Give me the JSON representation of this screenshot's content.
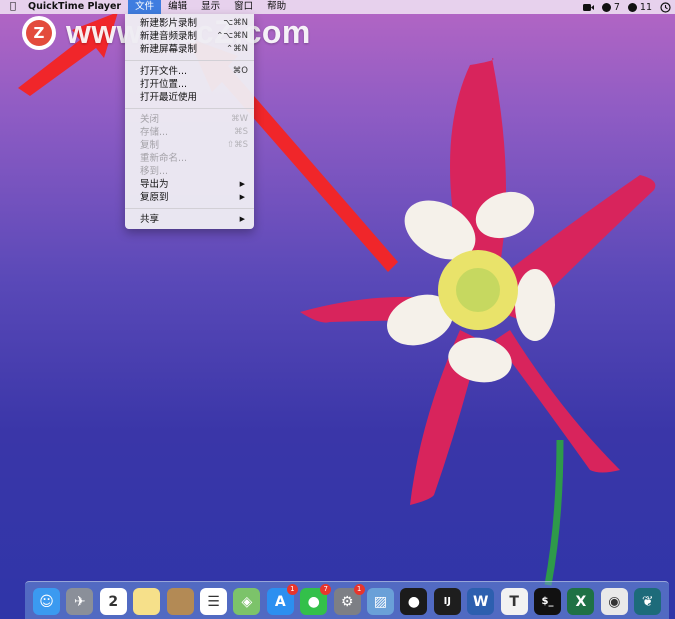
{
  "menubar": {
    "apple_icon": "",
    "app_name": "QuickTime Player",
    "menus": [
      "文件",
      "编辑",
      "显示",
      "窗口",
      "帮助"
    ],
    "active_menu_index": 0,
    "status": {
      "notification_count": "7",
      "account_count": "11"
    }
  },
  "watermark": {
    "logo_letter": "Z",
    "text": "www.MacZ.com"
  },
  "file_menu": {
    "items": [
      {
        "label": "新建影片录制",
        "shortcut": "⌥⌘N",
        "enabled": true
      },
      {
        "label": "新建音频录制",
        "shortcut": "⌃⌥⌘N",
        "enabled": true
      },
      {
        "label": "新建屏幕录制",
        "shortcut": "⌃⌘N",
        "enabled": true
      },
      {
        "label": "打开文件...",
        "shortcut": "⌘O",
        "enabled": true
      },
      {
        "label": "打开位置...",
        "shortcut": "",
        "enabled": true
      },
      {
        "label": "打开最近使用",
        "shortcut": "",
        "enabled": true,
        "submenu": true
      },
      {
        "label": "关闭",
        "shortcut": "⌘W",
        "enabled": false
      },
      {
        "label": "存储...",
        "shortcut": "⌘S",
        "enabled": false
      },
      {
        "label": "复制",
        "shortcut": "⇧⌘S",
        "enabled": false
      },
      {
        "label": "重新命名...",
        "shortcut": "",
        "enabled": false
      },
      {
        "label": "移到...",
        "shortcut": "",
        "enabled": false
      },
      {
        "label": "导出为",
        "shortcut": "",
        "enabled": true,
        "submenu": true
      },
      {
        "label": "复原到",
        "shortcut": "",
        "enabled": true,
        "submenu": true
      },
      {
        "label": "共享",
        "shortcut": "",
        "enabled": true,
        "submenu": true
      }
    ]
  },
  "dock": {
    "apps": [
      {
        "name": "finder-icon",
        "glyph": "☺",
        "color": "#3b9af0"
      },
      {
        "name": "launchpad-icon",
        "glyph": "✈",
        "color": "#8a8f99"
      },
      {
        "name": "calendar-icon",
        "glyph": "2",
        "color": "#ffffff"
      },
      {
        "name": "notes-icon",
        "glyph": "",
        "color": "#f6e08a"
      },
      {
        "name": "contacts-icon",
        "glyph": "",
        "color": "#b38a55"
      },
      {
        "name": "reminders-icon",
        "glyph": "☰",
        "color": "#ffffff"
      },
      {
        "name": "maps-icon",
        "glyph": "◈",
        "color": "#7cc36a"
      },
      {
        "name": "app-store-icon",
        "glyph": "A",
        "color": "#2c8ff0",
        "badge": "1"
      },
      {
        "name": "wechat-icon",
        "glyph": "●",
        "color": "#33c04a",
        "badge": "7"
      },
      {
        "name": "system-preferences-icon",
        "glyph": "⚙",
        "color": "#7d7f85",
        "badge": "1"
      },
      {
        "name": "preview-icon",
        "glyph": "▨",
        "color": "#6aa0d8"
      },
      {
        "name": "qq-icon",
        "glyph": "●",
        "color": "#1b1b1b"
      },
      {
        "name": "intellij-icon",
        "glyph": "IJ",
        "color": "#1e1e1e"
      },
      {
        "name": "word-icon",
        "glyph": "W",
        "color": "#2d5faf"
      },
      {
        "name": "typora-icon",
        "glyph": "T",
        "color": "#f2f2f2"
      },
      {
        "name": "terminal-icon",
        "glyph": "$_",
        "color": "#111111"
      },
      {
        "name": "excel-icon",
        "glyph": "X",
        "color": "#1e7145"
      },
      {
        "name": "chrome-icon",
        "glyph": "◉",
        "color": "#e9e9e9"
      },
      {
        "name": "tree-app-icon",
        "glyph": "❦",
        "color": "#1d6b7a"
      }
    ]
  },
  "colors": {
    "menu_highlight": "#3f7de0",
    "arrow": "#f0262a",
    "flower": "#d8245c"
  }
}
